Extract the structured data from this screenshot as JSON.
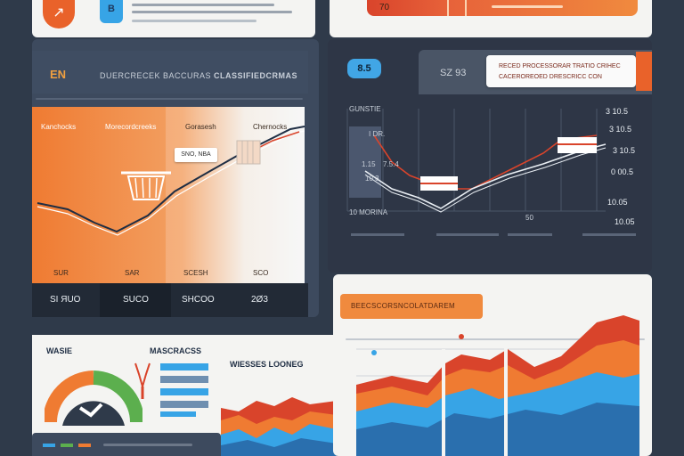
{
  "top": {
    "logo_glyph": "↗",
    "app_icon_text": "B",
    "bar_value_left": "70",
    "bar_text": ""
  },
  "left_panel": {
    "tag": "EN",
    "title_1": "DUERCRECEK BACCURAS",
    "title_2": "CLASSIFIEDCRMAS",
    "col_labels": [
      "Kanchocks",
      "Morecordcreeks",
      "Gorasesh",
      "Chernocks"
    ],
    "tooltip": "SNO, NBA",
    "bottom_inner_labels": [
      "SUR",
      "SAR",
      "SCESH",
      "SCO"
    ],
    "axis_labels": [
      "SI ЯUO",
      "SUCO",
      "SHCOO",
      "2Ø3"
    ]
  },
  "right_panel": {
    "pill": "8.5",
    "tab_label": "SZ 93",
    "callout_line1": "RECED PROCESSORAR TRATIO CRIHEC",
    "callout_line2": "CACEROREOED DRESCRICC CON",
    "y_labels": [
      "3 10.5",
      "3 10.5",
      "3 10.5",
      "0 00.5",
      "10.05",
      "10.05"
    ],
    "mid_label": "50",
    "legend_items": [
      "1.15",
      "7.5.4",
      "10:3"
    ],
    "small_labels": [
      "GUNSTIE",
      "I DR.",
      "10 MORINA"
    ],
    "tick_marks": [
      "",
      "",
      "",
      ""
    ]
  },
  "bottom_left": {
    "title_1": "WASIE",
    "title_2": "MASCRACSS"
  },
  "bottom_mid": {
    "title": "WIESSES LOONEG"
  },
  "bottom_right": {
    "header": "BEECSCORSNCOLATDAREM"
  },
  "colors": {
    "navy": "#2f3a4a",
    "orange": "#f08a3e",
    "red": "#d9442b",
    "blue": "#37a4e6",
    "green": "#5caf4e"
  }
}
